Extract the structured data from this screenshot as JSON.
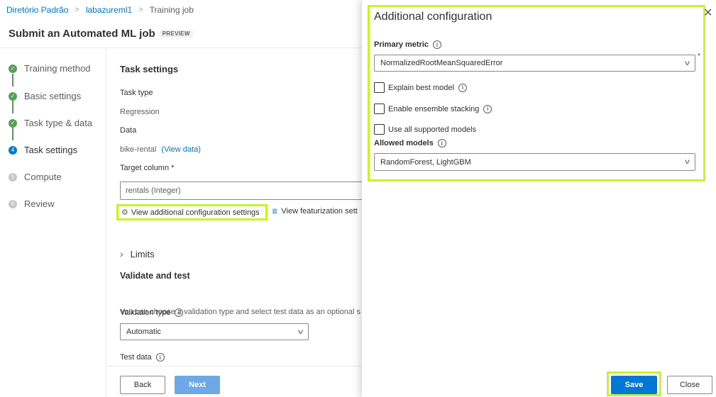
{
  "breadcrumb": {
    "items": [
      "Diretório Padrão",
      "labazureml1",
      "Training job"
    ]
  },
  "page": {
    "title": "Submit an Automated ML job",
    "badge": "PREVIEW"
  },
  "steps": [
    {
      "label": "Training method",
      "state": "done",
      "marker": "✓"
    },
    {
      "label": "Basic settings",
      "state": "done",
      "marker": "✓"
    },
    {
      "label": "Task type & data",
      "state": "done",
      "marker": "✓"
    },
    {
      "label": "Task settings",
      "state": "active",
      "marker": "4"
    },
    {
      "label": "Compute",
      "state": "pending",
      "marker": "5"
    },
    {
      "label": "Review",
      "state": "pending",
      "marker": "6"
    }
  ],
  "task_settings": {
    "title": "Task settings",
    "task_type_label": "Task type",
    "task_type_value": "Regression",
    "data_label": "Data",
    "data_value": "bike-rental",
    "view_data_link": "(View data)",
    "target_column_label": "Target column *",
    "target_column_value": "rentals (Integer)",
    "additional_config_link": "View additional configuration settings",
    "featurization_link": "View featurization sett",
    "limits_label": "Limits",
    "validate_title": "Validate and test",
    "validate_desc": "You can choose a validation type and select test data as an optional s",
    "validation_type_label": "Validation type",
    "validation_type_value": "Automatic",
    "test_data_label": "Test data"
  },
  "footer": {
    "back_label": "Back",
    "next_label": "Next"
  },
  "panel": {
    "title": "Additional configuration",
    "close_glyph": "✕",
    "primary_metric_label": "Primary metric",
    "primary_metric_value": "NormalizedRootMeanSquaredError",
    "required_mark": "*",
    "explain_label": "Explain best model",
    "ensemble_label": "Enable ensemble stacking",
    "all_models_label": "Use all supported models",
    "allowed_models_label": "Allowed models",
    "allowed_models_value": "RandomForest, LightGBM",
    "save_label": "Save",
    "close_label": "Close"
  },
  "icons": {
    "info": "i",
    "chevron_down": "v",
    "chevron_right": "›",
    "gear": "⚙",
    "featurization": "≣"
  },
  "colors": {
    "accent": "#0078d4",
    "highlight": "#c6f32a",
    "success": "#57a05a"
  }
}
